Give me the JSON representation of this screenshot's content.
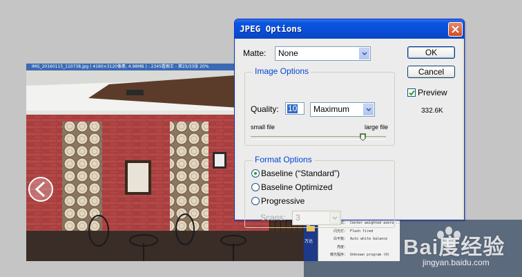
{
  "viewer": {
    "title": "IMG_20160115_110738.jpg ( 4160×3120像素, 4.98MB ) - 2345看图王 - 第25/33张 20%"
  },
  "side_window": {
    "folder_label": "万达",
    "exif": [
      {
        "key": "测光模式：",
        "value": "Center weighted avera..."
      },
      {
        "key": "闪光灯：",
        "value": "Flash fired"
      },
      {
        "key": "白平衡：",
        "value": "Auto white balance"
      },
      {
        "key": "亮度：",
        "value": ""
      },
      {
        "key": "曝光程序：",
        "value": "Unknown program (0)"
      }
    ]
  },
  "watermark": {
    "brand": "Bai度经验",
    "url": "jingyan.baidu.com"
  },
  "dialog": {
    "title": "JPEG Options",
    "matte_label": "Matte:",
    "matte_value": "None",
    "image_options": {
      "title": "Image Options",
      "quality_label": "Quality:",
      "quality_value": "10",
      "quality_preset": "Maximum",
      "small_file_label": "small file",
      "large_file_label": "large file",
      "quality_slider_fraction": 0.83
    },
    "format_options": {
      "title": "Format Options",
      "options": [
        {
          "label": "Baseline (“Standard”)",
          "selected": true
        },
        {
          "label": "Baseline Optimized",
          "selected": false
        },
        {
          "label": "Progressive",
          "selected": false
        }
      ],
      "scans_label": "Scans:",
      "scans_value": "3"
    },
    "ok_label": "OK",
    "cancel_label": "Cancel",
    "preview_label": "Preview",
    "preview_checked": true,
    "file_size": "332.6K"
  },
  "colors": {
    "titlebar": "#0a55e0",
    "group_title": "#0046d5",
    "dialog_bg": "#ececec",
    "brick": "#a53a3a"
  }
}
